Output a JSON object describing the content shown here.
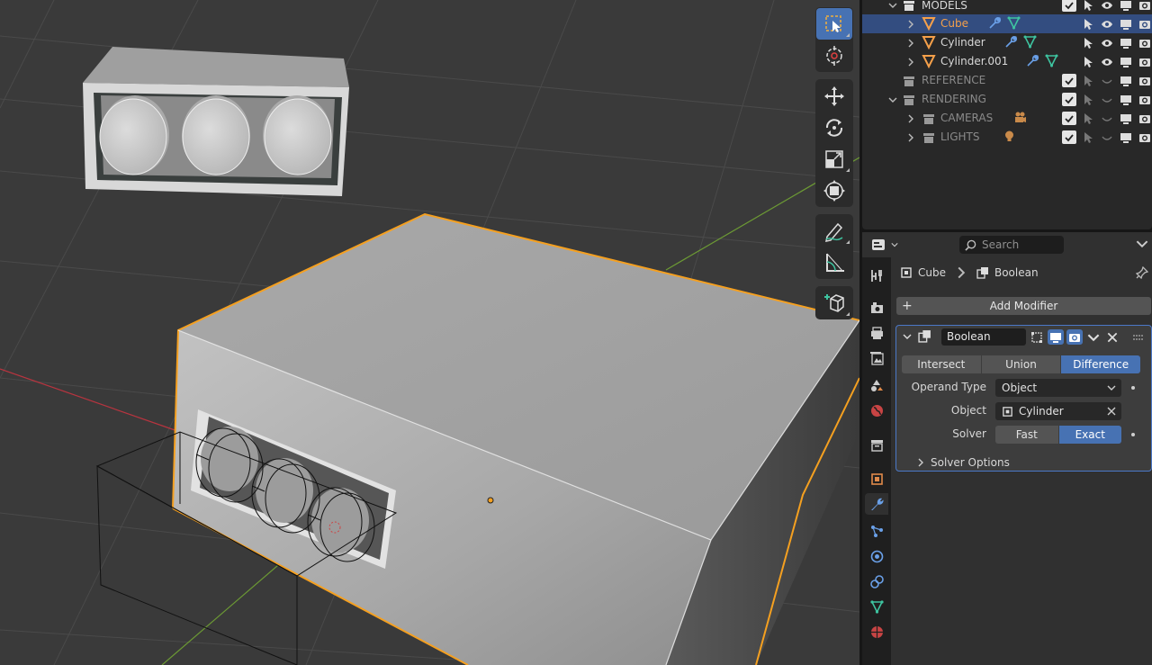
{
  "outliner": {
    "rows": [
      {
        "name": "MODELS",
        "kind": "collection",
        "dim": false,
        "selected": false,
        "highlight": false
      },
      {
        "name": "Cube",
        "kind": "mesh",
        "dim": false,
        "selected": true,
        "highlight": true
      },
      {
        "name": "Cylinder",
        "kind": "mesh",
        "dim": false,
        "selected": false,
        "highlight": false
      },
      {
        "name": "Cylinder.001",
        "kind": "mesh",
        "dim": false,
        "selected": false,
        "highlight": false
      },
      {
        "name": "REFERENCE",
        "kind": "collection",
        "dim": true,
        "selected": false,
        "highlight": false
      },
      {
        "name": "RENDERING",
        "kind": "collection",
        "dim": true,
        "selected": false,
        "highlight": false
      },
      {
        "name": "CAMERAS",
        "kind": "collection",
        "dim": true,
        "selected": false,
        "highlight": false
      },
      {
        "name": "LIGHTS",
        "kind": "collection",
        "dim": true,
        "selected": false,
        "highlight": false
      }
    ]
  },
  "properties": {
    "search_placeholder": "Search",
    "breadcrumb": {
      "object": "Cube",
      "modifier": "Boolean"
    },
    "add_modifier_label": "Add Modifier",
    "modifier": {
      "name": "Boolean",
      "operations": [
        "Intersect",
        "Union",
        "Difference"
      ],
      "active_operation": "Difference",
      "operand_type_label": "Operand Type",
      "operand_type_value": "Object",
      "object_label": "Object",
      "object_value": "Cylinder",
      "solver_label": "Solver",
      "solver_options": [
        "Fast",
        "Exact"
      ],
      "active_solver": "Exact",
      "solver_options_panel": "Solver Options"
    }
  },
  "colors": {
    "accent": "#4772b3",
    "selection_outline": "#f5a020",
    "outliner_selected": "#334d80",
    "modifier_green": "#3ec4a0",
    "modifier_blue": "#6aa0e8"
  }
}
